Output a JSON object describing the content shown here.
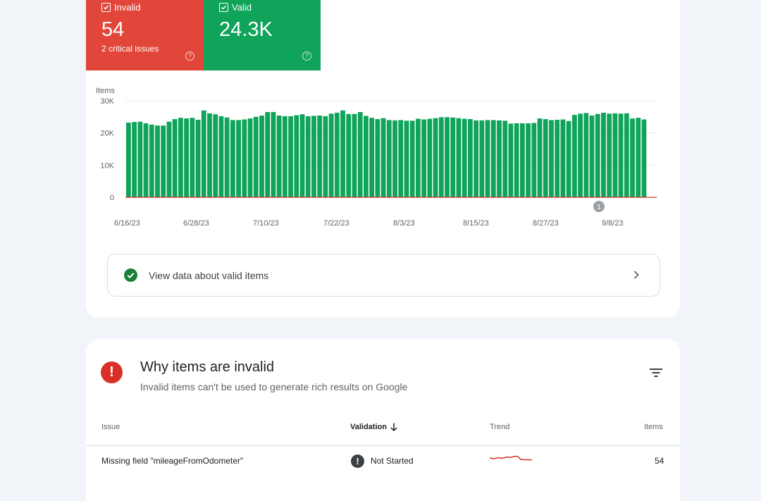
{
  "tiles": {
    "invalid": {
      "label": "Invalid",
      "count": "54",
      "sublabel": "2 critical issues",
      "help": "?"
    },
    "valid": {
      "label": "Valid",
      "count": "24.3K",
      "help": "?"
    }
  },
  "chart_data": {
    "type": "bar",
    "ylabel": "Items",
    "yticks": [
      "30K",
      "20K",
      "10K",
      "0"
    ],
    "ylim": [
      0,
      30000
    ],
    "xtick_labels": [
      "6/16/23",
      "6/28/23",
      "7/10/23",
      "7/22/23",
      "8/3/23",
      "8/15/23",
      "8/27/23",
      "9/8/23"
    ],
    "annotation": "1",
    "series": [
      {
        "color": "#10a35a",
        "values": [
          23200,
          23400,
          23500,
          23000,
          22600,
          22300,
          22300,
          23500,
          24300,
          24700,
          24500,
          24700,
          24100,
          27000,
          26100,
          25800,
          25200,
          24800,
          24000,
          24000,
          24200,
          24500,
          25000,
          25400,
          26500,
          26500,
          25400,
          25200,
          25200,
          25500,
          25800,
          25200,
          25300,
          25400,
          25200,
          26000,
          26300,
          27000,
          25900,
          25900,
          26500,
          25300,
          24700,
          24300,
          24600,
          24000,
          23900,
          24000,
          23800,
          23800,
          24400,
          24200,
          24400,
          24600,
          24900,
          24900,
          24800,
          24600,
          24400,
          24300,
          23900,
          23900,
          24000,
          24000,
          23900,
          23800,
          22900,
          23000,
          23000,
          23000,
          23100,
          24500,
          24300,
          24000,
          24100,
          24200,
          23700,
          25600,
          26000,
          26200,
          25400,
          25900,
          26300,
          26000,
          26100,
          26000,
          26100,
          24500,
          24700,
          24200
        ]
      }
    ]
  },
  "valid_row": {
    "label": "View data about valid items"
  },
  "section": {
    "title": "Why items are invalid",
    "subtitle": "Invalid items can't be used to generate rich results on Google"
  },
  "table": {
    "headers": {
      "issue": "Issue",
      "validation": "Validation",
      "trend": "Trend",
      "items": "Items"
    },
    "rows": [
      {
        "issue": "Missing field \"mileageFromOdometer\"",
        "validation": "Not Started",
        "items": "54"
      }
    ]
  },
  "colors": {
    "invalid": "#e2463a",
    "valid": "#10a35a",
    "error": "#d93025",
    "trend": "#d93025"
  }
}
